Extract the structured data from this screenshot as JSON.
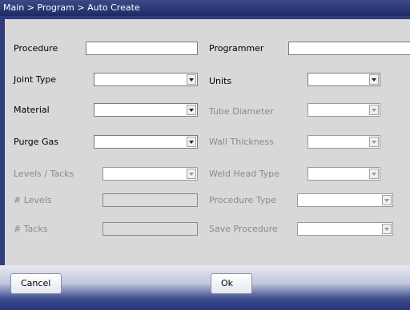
{
  "breadcrumb": "Main > Program > Auto Create",
  "fields": {
    "procedure": {
      "label": "Procedure",
      "value": ""
    },
    "programmer": {
      "label": "Programmer",
      "value": ""
    },
    "joint_type": {
      "label": "Joint Type",
      "value": ""
    },
    "units": {
      "label": "Units",
      "value": ""
    },
    "material": {
      "label": "Material",
      "value": ""
    },
    "tube_diameter": {
      "label": "Tube Diameter",
      "value": ""
    },
    "purge_gas": {
      "label": "Purge Gas",
      "value": ""
    },
    "wall_thickness": {
      "label": "Wall Thickness",
      "value": ""
    },
    "levels_tacks": {
      "label": "Levels / Tacks",
      "value": ""
    },
    "weld_head_type": {
      "label": "Weld Head Type",
      "value": ""
    },
    "num_levels": {
      "label": "# Levels",
      "value": ""
    },
    "procedure_type": {
      "label": "Procedure Type",
      "value": ""
    },
    "num_tacks": {
      "label": "# Tacks",
      "value": ""
    },
    "save_procedure": {
      "label": "Save Procedure",
      "value": ""
    }
  },
  "buttons": {
    "cancel": "Cancel",
    "ok": "Ok"
  },
  "colors": {
    "frame": "#2f3d80",
    "panel": "#d8d8d8",
    "disabled_text": "#8a8a8a"
  }
}
